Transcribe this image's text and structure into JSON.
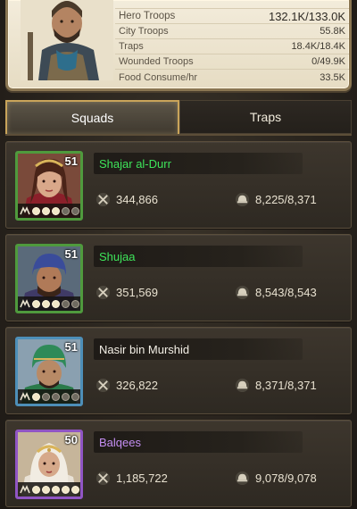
{
  "summary": {
    "rows": [
      {
        "label": "Hero Troops",
        "value": "132.1K/133.0K"
      },
      {
        "label": "City Troops",
        "value": "55.8K"
      },
      {
        "label": "Traps",
        "value": "18.4K/18.4K"
      },
      {
        "label": "Wounded Troops",
        "value": "0/49.9K"
      },
      {
        "label": "Food Consume/hr",
        "value": "33.5K"
      }
    ]
  },
  "tabs": [
    {
      "label": "Squads",
      "active": true
    },
    {
      "label": "Traps",
      "active": false
    }
  ],
  "squads": [
    {
      "name": "Shajar al-Durr",
      "level": "51",
      "power": "344,866",
      "troops": "8,225/8,371",
      "stars": 3,
      "rarity": "green",
      "name_color": "#3ee45a"
    },
    {
      "name": "Shujaa",
      "level": "51",
      "power": "351,569",
      "troops": "8,543/8,543",
      "stars": 3,
      "rarity": "green",
      "name_color": "#3ee45a"
    },
    {
      "name": "Nasir bin Murshid",
      "level": "51",
      "power": "326,822",
      "troops": "8,371/8,371",
      "stars": 1,
      "rarity": "blue",
      "name_color": "#f3efe6"
    },
    {
      "name": "Balqees",
      "level": "50",
      "power": "1,185,722",
      "troops": "9,078/9,078",
      "stars": 5,
      "rarity": "purple",
      "name_color": "#c48ef2"
    }
  ],
  "icons": {
    "power": "crossed-swords-icon",
    "troops": "troop-helmet-icon",
    "rank": "rank-chevron-icon"
  }
}
